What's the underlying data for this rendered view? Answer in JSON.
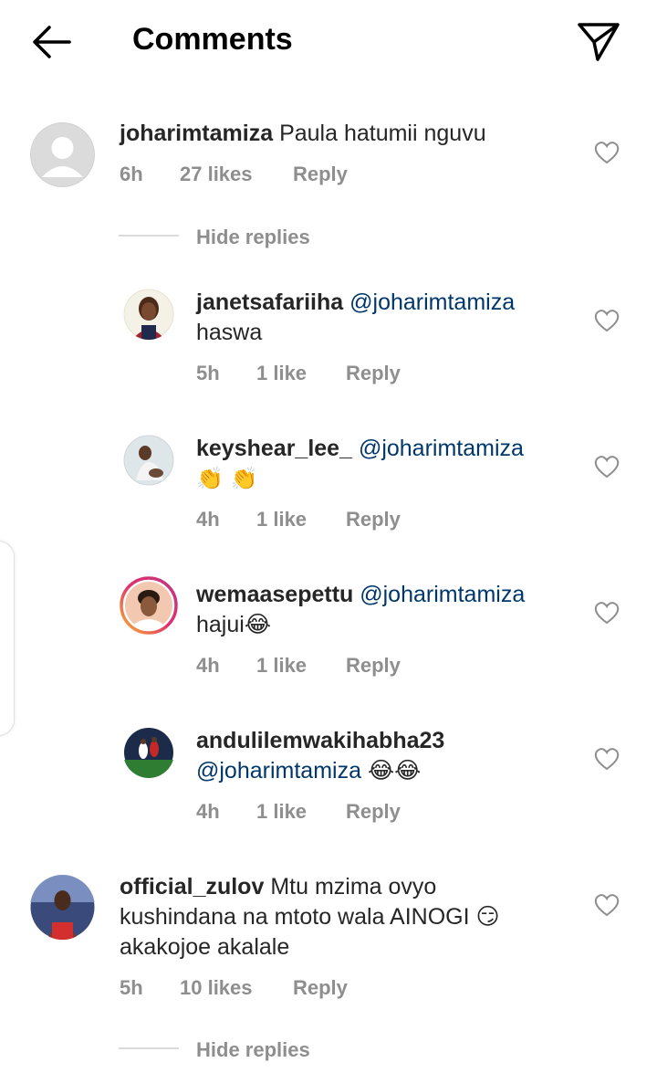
{
  "header": {
    "title": "Comments",
    "back_icon": "arrow-left-icon",
    "send_icon": "paper-plane-icon"
  },
  "comments": [
    {
      "username": "joharimtamiza",
      "text": "Paula hatumii nguvu",
      "time": "6h",
      "likes": "27 likes",
      "reply": "Reply",
      "hide_replies": "Hide replies",
      "replies": [
        {
          "username": "janetsafariiha",
          "mention": "@joharimtamiza",
          "text": "haswa",
          "time": "5h",
          "likes": "1 like",
          "reply": "Reply"
        },
        {
          "username": "keyshear_lee_",
          "mention": "@joharimtamiza",
          "text": "👏 👏",
          "time": "4h",
          "likes": "1 like",
          "reply": "Reply"
        },
        {
          "username": "wemaasepettu",
          "mention": "@joharimtamiza",
          "text": "hajui😂",
          "time": "4h",
          "likes": "1 like",
          "reply": "Reply"
        },
        {
          "username": "andulilemwakihabha23",
          "mention": "@joharimtamiza",
          "text": "😂😂",
          "time": "4h",
          "likes": "1 like",
          "reply": "Reply"
        }
      ]
    },
    {
      "username": "official_zulov",
      "text_line1": "Mtu mzima ovyo",
      "text_line2": "kushindana na mtoto wala AINOGI 😏",
      "text_line3": "akakojoe akalale",
      "time": "5h",
      "likes": "10 likes",
      "reply": "Reply",
      "hide_replies": "Hide replies"
    }
  ],
  "colors": {
    "text": "#262626",
    "meta": "#8e8e8e",
    "mention": "#00376b",
    "divider": "#dbdbdb"
  }
}
